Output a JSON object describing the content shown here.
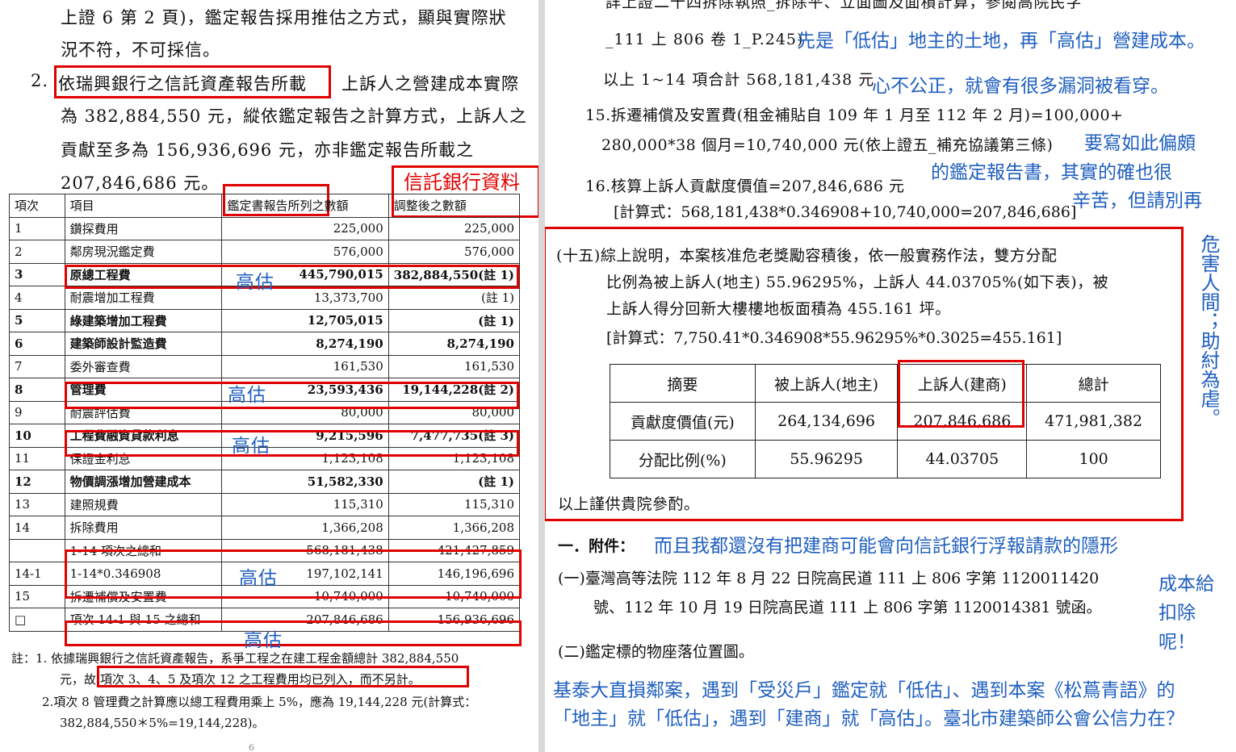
{
  "left": {
    "para1_line1": "上證 6 第 2 頁)，鑑定報告採用推估之方式，顯與實際狀",
    "para1_line2": "況不符，不可採信。",
    "para2_num": "2.",
    "para2_highlight": "依瑞興銀行之信託資產報告所載",
    "para2_line1_rest": "上訴人之營建成本實際",
    "para2_line2": "為 382,884,550 元，縱依鑑定報告之計算方式，上訴人之",
    "para2_line3": "貢獻至多為 156,936,696 元，亦非鑑定報告所載之",
    "para2_line4": "207,846,686 元。",
    "trust_bank_label": "信託銀行資料",
    "table_headers": [
      "項次",
      "項目",
      "鑑定書報告所列之數額",
      "調整後之數額"
    ],
    "rows": [
      {
        "no": "1",
        "item": "鑽探費用",
        "a": "225,000",
        "b": "225,000",
        "bold": false
      },
      {
        "no": "2",
        "item": "鄰房現況鑑定費",
        "a": "576,000",
        "b": "576,000",
        "bold": false
      },
      {
        "no": "3",
        "item": "原總工程費",
        "a": "445,790,015",
        "b": "382,884,550(註 1)",
        "bold": true
      },
      {
        "no": "4",
        "item": "耐震增加工程費",
        "a": "13,373,700",
        "b": "(註 1)",
        "bold": false
      },
      {
        "no": "5",
        "item": "綠建築增加工程費",
        "a": "12,705,015",
        "b": "(註 1)",
        "bold": true
      },
      {
        "no": "6",
        "item": "建築師設計監造費",
        "a": "8,274,190",
        "b": "8,274,190",
        "bold": true
      },
      {
        "no": "7",
        "item": "委外審查費",
        "a": "161,530",
        "b": "161,530",
        "bold": false
      },
      {
        "no": "8",
        "item": "管理費",
        "a": "23,593,436",
        "b": "19,144,228(註 2)",
        "bold": true
      },
      {
        "no": "9",
        "item": "耐震評估費",
        "a": "80,000",
        "b": "80,000",
        "bold": false
      },
      {
        "no": "10",
        "item": "工程費融資貸款利息",
        "a": "9,215,596",
        "b": "7,477,735(註 3)",
        "bold": true
      },
      {
        "no": "11",
        "item": "保證金利息",
        "a": "1,123,108",
        "b": "1,123,108",
        "bold": false
      },
      {
        "no": "12",
        "item": "物價調漲增加營建成本",
        "a": "51,582,330",
        "b": "(註 1)",
        "bold": true
      },
      {
        "no": "13",
        "item": "建照規費",
        "a": "115,310",
        "b": "115,310",
        "bold": false
      },
      {
        "no": "14",
        "item": "拆除費用",
        "a": "1,366,208",
        "b": "1,366,208",
        "bold": false
      },
      {
        "no": "",
        "item": "1-14 項次之總和",
        "a": "568,181,438",
        "b": "421,427,859",
        "bold": false
      },
      {
        "no": "14-1",
        "item": "1-14*0.346908",
        "a": "197,102,141",
        "b": "146,196,696",
        "bold": false
      },
      {
        "no": "15",
        "item": "拆遷補償及安置費",
        "a": "10,740,000",
        "b": "10,740,000",
        "bold": false
      },
      {
        "no": "□",
        "item": "項次 14-1 與 15 之總和",
        "a": "207,846,686",
        "b": "156,936,696",
        "bold": false
      }
    ],
    "overestimate_label": "高估",
    "note1_line1": "註：1. 依據瑞興銀行之信託資產報告，系爭工程之在建工程金額總計 382,884,550",
    "note1_line2_pre": "元，故",
    "note1_line2_box": "項次 3、4、5 及項次 12 之工程費用均已列入，而不另計。",
    "note2_line1": "2.項次 8 管理費之計算應以總工程費用乘上 5%，應為 19,144,228 元(計算式：",
    "note2_line2": "382,884,550＊5%=19,144,228)。",
    "page_num": "6"
  },
  "right": {
    "top_cut": "詳上證二十四拆除執照_拆除平、立面圖及面積計算，參閱高院民字",
    "line_ref": "_111 上 806 卷 1_P.245)",
    "blue1": "先是「低估」地主的土地，再「高估」營建成本。",
    "line_total": "以上 1~14 項合計 568,181,438 元",
    "blue2": "心不公正，就會有很多漏洞被看穿。",
    "item15_line1": "15.拆遷補償及安置費(租金補貼自 109 年 1 月至 112 年 2 月)=100,000+",
    "item15_line2": "280,000*38 個月=10,740,000 元(依上證五_補充協議第三條)",
    "blue3_l1": "要寫如此偏頗",
    "blue3_l2": "的鑑定報告書，其實的確也很",
    "item16": "16.核算上訴人貢獻度價值=207,846,686 元",
    "blue3_l3": "辛苦，但請別再",
    "calc16": "[計算式：568,181,438*0.346908+10,740,000=207,846,686]",
    "s15_line1": "(十五)綜上說明，本案核准危老獎勵容積後，依一般實務作法，雙方分配",
    "s15_line2": "比例為被上訴人(地主) 55.96295%，上訴人 44.03705%(如下表)，被",
    "s15_line3": "上訴人得分回新大樓樓地板面積為 455.161 坪。",
    "s15_calc": "[計算式：7,750.41*0.346908*55.96295%*0.3025=455.161]",
    "sum_headers": [
      "摘要",
      "被上訴人(地主)",
      "上訴人(建商)",
      "總計"
    ],
    "sum_row1": [
      "貢獻度價值(元)",
      "264,134,696",
      "207,846,686",
      "471,981,382"
    ],
    "sum_row2": [
      "分配比例(%)",
      "55.96295",
      "44.03705",
      "100"
    ],
    "closing": "以上謹供貴院參酌。",
    "vertical_blue": "危害人間；助紂為虐。",
    "attach_label": "一．附件：",
    "blue4": "而且我都還沒有把建商可能會向信託銀行浮報請款的隱形",
    "attach1_line1": "(一)臺灣高等法院 112 年 8 月 22 日院高民道 111 上 806 字第 1120011420",
    "attach1_line2": "號、112 年 10 月 19 日院高民道 111 上 806 字第 1120014381 號函。",
    "blue5_l1": "成本給",
    "blue5_l2": "扣除",
    "blue5_l3": "呢！",
    "attach2": "(二)鑑定標的物座落位置圖。",
    "bottom_blue1": "基泰大直損鄰案，遇到「受災戶」鑑定就「低估」、遇到本案《松蔦青語》的",
    "bottom_blue2": "「地主」就「低估」，遇到「建商」就「高估」。臺北市建築師公會公信力在？"
  }
}
